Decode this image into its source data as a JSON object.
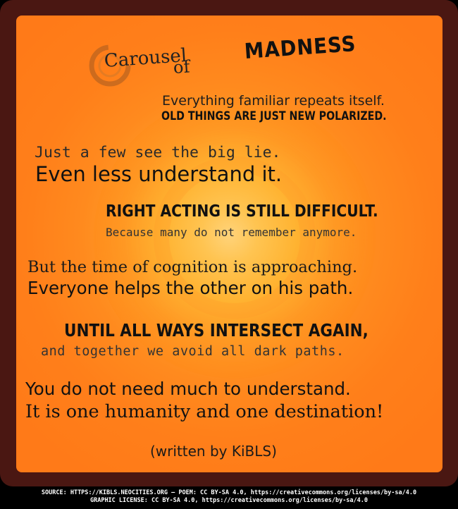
{
  "poster": {
    "title": {
      "part1": "Carousel",
      "part2": "of",
      "part3": "MADNESS"
    },
    "lines": [
      "Everything familiar repeats itself.",
      "OLD THINGS ARE JUST NEW POLARIZED.",
      "Just a few see the big lie.",
      "Even less understand it.",
      "RIGHT ACTING IS STILL DIFFICULT.",
      "Because many do not remember anymore.",
      "But the time of cognition is approaching.",
      "Everyone helps the other on his path.",
      "UNTIL ALL WAYS INTERSECT AGAIN,",
      "and together we avoid all dark paths.",
      "You do not need much to understand.",
      "It is one humanity and one destination!"
    ],
    "author": "(written by KiBLS)"
  },
  "footer": {
    "line1": "SOURCE: HTTPS://KIBLS.NEOCITIES.ORG — POEM: CC BY-SA 4.0, https://creativecommons.org/licenses/by-sa/4.0",
    "line2": "GRAPHIC LICENSE: CC BY-SA 4.0, https://creativecommons.org/licenses/by-sa/4.0"
  },
  "icons": {
    "swirl": "swirl-icon"
  },
  "colors": {
    "frame": "#4a1712",
    "poster_center": "#ffd37a",
    "poster_edge": "#ff7a18",
    "text": "#111111",
    "footer_text": "#ffffff"
  }
}
